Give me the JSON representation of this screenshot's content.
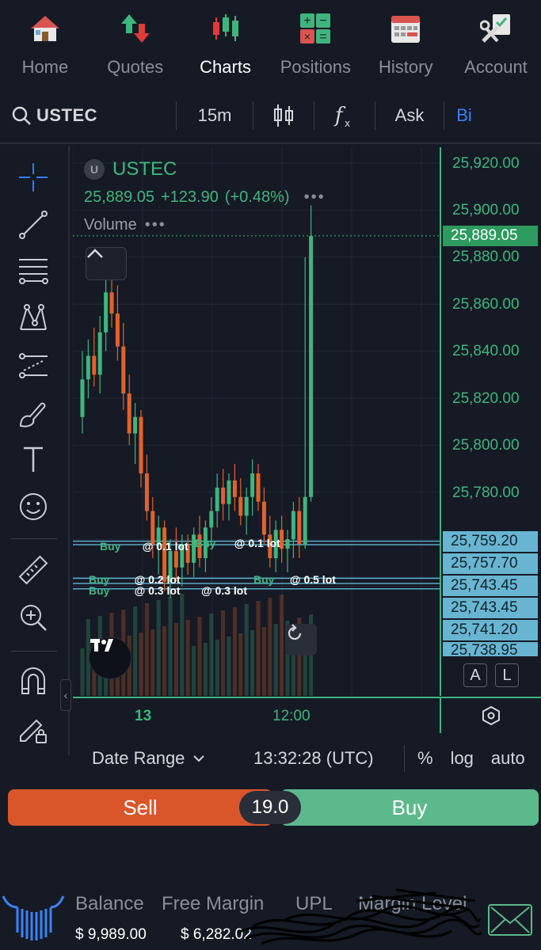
{
  "nav": [
    {
      "label": "Home",
      "icon": "house-icon"
    },
    {
      "label": "Quotes",
      "icon": "up-down-arrows-icon"
    },
    {
      "label": "Charts",
      "icon": "candlestick-icon",
      "active": true
    },
    {
      "label": "Positions",
      "icon": "calculator-icon"
    },
    {
      "label": "History",
      "icon": "calendar-icon"
    },
    {
      "label": "Account",
      "icon": "tools-icon"
    }
  ],
  "toolbar": {
    "symbol": "USTEC",
    "interval": "15m",
    "ask_label": "Ask",
    "bid_label": "Bi"
  },
  "legend": {
    "badge": "U",
    "symbol": "USTEC",
    "price": "25,889.05",
    "change": "+123.90",
    "change_pct": "(+0.48%)",
    "volume_label": "Volume"
  },
  "price_axis": {
    "ticks": [
      "25,920.00",
      "25,900.00",
      "25,880.00",
      "25,860.00",
      "25,840.00",
      "25,820.00",
      "25,800.00",
      "25,780.00"
    ],
    "current_price": "25,889.05",
    "order_prices": [
      "25,759.20",
      "25,757.70",
      "25,743.45",
      "25,743.45",
      "25,741.20",
      "25,738.95"
    ],
    "a_label": "A",
    "l_label": "L"
  },
  "orders": [
    {
      "side": "Buy",
      "lot": "@ 0.1 lot"
    },
    {
      "side": "Buy",
      "lot": "@ 0.1 lot"
    },
    {
      "side": "Buy",
      "lot": "@ 0.2 lot"
    },
    {
      "side": "Buy",
      "lot": "@ 0.3 lot"
    },
    {
      "side": "",
      "lot": "@ 0.3 lot"
    },
    {
      "side": "Buy",
      "lot": "@ 0.5 lot"
    }
  ],
  "time_axis": {
    "ticks": [
      "13",
      "12:00"
    ]
  },
  "bottom_bar": {
    "date_range": "Date Range",
    "clock": "13:32:28 (UTC)",
    "percent": "%",
    "log": "log",
    "auto": "auto"
  },
  "trade": {
    "sell": "Sell",
    "quantity": "19.0",
    "buy": "Buy"
  },
  "account": {
    "headers": [
      "Balance",
      "Free Margin",
      "UPL",
      "Margin Level"
    ],
    "balance": "$ 9,989.00",
    "free_margin": "$ 6,282.02"
  },
  "colors": {
    "up": "#3fb57e",
    "down": "#e0632a",
    "sell": "#d8562a",
    "buy": "#5bb98c",
    "order_line": "#5aa9c7",
    "background": "#161a25"
  },
  "chart_data": {
    "type": "candlestick",
    "symbol": "USTEC",
    "interval": "15m",
    "ylim": [
      25735,
      25922
    ],
    "x_ticks": [
      "13",
      "12:00"
    ],
    "grid": true,
    "last_price": 25889.05,
    "order_levels": [
      25759.2,
      25757.7,
      25743.45,
      25743.45,
      25741.2,
      25738.95
    ],
    "candles": [
      {
        "o": 25812,
        "h": 25840,
        "l": 25805,
        "c": 25828
      },
      {
        "o": 25828,
        "h": 25845,
        "l": 25820,
        "c": 25838
      },
      {
        "o": 25838,
        "h": 25850,
        "l": 25825,
        "c": 25830
      },
      {
        "o": 25830,
        "h": 25855,
        "l": 25822,
        "c": 25848
      },
      {
        "o": 25848,
        "h": 25872,
        "l": 25840,
        "c": 25865
      },
      {
        "o": 25865,
        "h": 25876,
        "l": 25850,
        "c": 25856
      },
      {
        "o": 25856,
        "h": 25868,
        "l": 25836,
        "c": 25842
      },
      {
        "o": 25842,
        "h": 25852,
        "l": 25815,
        "c": 25822
      },
      {
        "o": 25822,
        "h": 25830,
        "l": 25800,
        "c": 25805
      },
      {
        "o": 25805,
        "h": 25818,
        "l": 25792,
        "c": 25812
      },
      {
        "o": 25812,
        "h": 25815,
        "l": 25782,
        "c": 25788
      },
      {
        "o": 25788,
        "h": 25796,
        "l": 25768,
        "c": 25772
      },
      {
        "o": 25772,
        "h": 25778,
        "l": 25752,
        "c": 25758
      },
      {
        "o": 25758,
        "h": 25770,
        "l": 25745,
        "c": 25765
      },
      {
        "o": 25765,
        "h": 25768,
        "l": 25738,
        "c": 25742
      },
      {
        "o": 25742,
        "h": 25760,
        "l": 25735,
        "c": 25755
      },
      {
        "o": 25755,
        "h": 25765,
        "l": 25742,
        "c": 25748
      },
      {
        "o": 25748,
        "h": 25762,
        "l": 25740,
        "c": 25758
      },
      {
        "o": 25758,
        "h": 25762,
        "l": 25745,
        "c": 25750
      },
      {
        "o": 25750,
        "h": 25765,
        "l": 25744,
        "c": 25762
      },
      {
        "o": 25762,
        "h": 25770,
        "l": 25748,
        "c": 25752
      },
      {
        "o": 25752,
        "h": 25768,
        "l": 25746,
        "c": 25765
      },
      {
        "o": 25765,
        "h": 25778,
        "l": 25758,
        "c": 25772
      },
      {
        "o": 25772,
        "h": 25788,
        "l": 25765,
        "c": 25782
      },
      {
        "o": 25782,
        "h": 25790,
        "l": 25768,
        "c": 25775
      },
      {
        "o": 25775,
        "h": 25788,
        "l": 25768,
        "c": 25785
      },
      {
        "o": 25785,
        "h": 25792,
        "l": 25772,
        "c": 25778
      },
      {
        "o": 25778,
        "h": 25786,
        "l": 25766,
        "c": 25770
      },
      {
        "o": 25770,
        "h": 25782,
        "l": 25762,
        "c": 25778
      },
      {
        "o": 25778,
        "h": 25794,
        "l": 25770,
        "c": 25788
      },
      {
        "o": 25788,
        "h": 25792,
        "l": 25772,
        "c": 25776
      },
      {
        "o": 25776,
        "h": 25782,
        "l": 25758,
        "c": 25762
      },
      {
        "o": 25762,
        "h": 25770,
        "l": 25748,
        "c": 25752
      },
      {
        "o": 25752,
        "h": 25768,
        "l": 25746,
        "c": 25764
      },
      {
        "o": 25764,
        "h": 25770,
        "l": 25750,
        "c": 25756
      },
      {
        "o": 25756,
        "h": 25764,
        "l": 25746,
        "c": 25760
      },
      {
        "o": 25760,
        "h": 25776,
        "l": 25752,
        "c": 25772
      },
      {
        "o": 25772,
        "h": 25778,
        "l": 25752,
        "c": 25758
      },
      {
        "o": 25758,
        "h": 25880,
        "l": 25756,
        "c": 25778
      },
      {
        "o": 25778,
        "h": 25902,
        "l": 25776,
        "c": 25889
      }
    ]
  }
}
